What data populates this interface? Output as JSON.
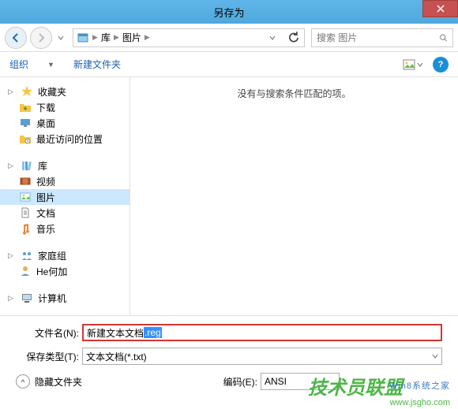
{
  "window": {
    "title": "另存为"
  },
  "nav": {
    "address_parts": [
      "库",
      "图片"
    ],
    "search_placeholder": "搜索 图片"
  },
  "toolbar": {
    "organize": "组织",
    "new_folder": "新建文件夹"
  },
  "sidebar": {
    "favorites": {
      "label": "收藏夹",
      "items": [
        {
          "label": "下载",
          "icon": "download"
        },
        {
          "label": "桌面",
          "icon": "desktop"
        },
        {
          "label": "最近访问的位置",
          "icon": "recent"
        }
      ]
    },
    "libraries": {
      "label": "库",
      "items": [
        {
          "label": "视频",
          "icon": "video"
        },
        {
          "label": "图片",
          "icon": "pic",
          "selected": true
        },
        {
          "label": "文档",
          "icon": "doc"
        },
        {
          "label": "音乐",
          "icon": "music"
        }
      ]
    },
    "homegroup": {
      "label": "家庭组",
      "items": [
        {
          "label": "He何加",
          "icon": "user"
        }
      ]
    },
    "computer": {
      "label": "计算机"
    }
  },
  "main": {
    "empty_message": "没有与搜索条件匹配的项。"
  },
  "bottom": {
    "filename_label": "文件名(N):",
    "filename_value_prefix": "新建文本文档",
    "filename_value_selected": ".reg",
    "filetype_label": "保存类型(T):",
    "filetype_value": "文本文档(*.txt)",
    "hide_folders": "隐藏文件夹",
    "encoding_label": "编码(E):",
    "encoding_value": "ANSI"
  },
  "watermark": {
    "text1": "技术员联盟",
    "text2": "www.jsgho.com",
    "text3": "Win8系统之家"
  }
}
